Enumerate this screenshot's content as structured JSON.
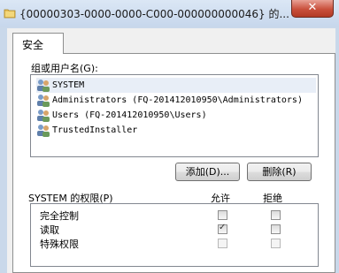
{
  "window": {
    "title": "{00000303-0000-0000-C000-000000000046} 的...",
    "close_label": "✕"
  },
  "tabs": [
    {
      "label": "安全",
      "active": true
    }
  ],
  "group_section": {
    "label": "组或用户名(G):",
    "users": [
      {
        "name": "SYSTEM",
        "selected": true
      },
      {
        "name": "Administrators (FQ-201412010950\\Administrators)",
        "selected": false
      },
      {
        "name": "Users (FQ-201412010950\\Users)",
        "selected": false
      },
      {
        "name": "TrustedInstaller",
        "selected": false
      }
    ]
  },
  "buttons": {
    "add": "添加(D)...",
    "remove": "删除(R)"
  },
  "permissions": {
    "title": "SYSTEM 的权限(P)",
    "allow_header": "允许",
    "deny_header": "拒绝",
    "rows": [
      {
        "name": "完全控制",
        "allow": false,
        "deny": false,
        "enabled": true
      },
      {
        "name": "读取",
        "allow": true,
        "deny": false,
        "enabled": true
      },
      {
        "name": "特殊权限",
        "allow": false,
        "deny": false,
        "enabled": false
      }
    ]
  },
  "colors": {
    "close_button": "#c9503c",
    "selection": "#e8eef7"
  }
}
